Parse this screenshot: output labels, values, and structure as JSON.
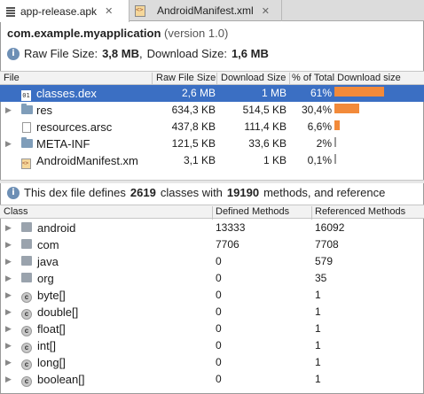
{
  "tabs": [
    {
      "label": "app-release.apk",
      "active": true
    },
    {
      "label": "AndroidManifest.xml",
      "active": false
    }
  ],
  "header": {
    "package": "com.example.myapplication",
    "version": "(version 1.0)",
    "raw_label": "Raw File Size:",
    "raw_value": "3,8 MB",
    "sep": ",",
    "download_label": "Download Size:",
    "download_value": "1,6 MB"
  },
  "files_table": {
    "columns": [
      "File",
      "Raw File Size",
      "Download Size",
      "% of Total Download size"
    ],
    "rows": [
      {
        "name": "classes.dex",
        "raw": "2,6 MB",
        "download": "1 MB",
        "percent": "61%",
        "share": 0.61,
        "selected": true,
        "icon": "dex-file-icon",
        "expandable": false
      },
      {
        "name": "res",
        "raw": "634,3 KB",
        "download": "514,5 KB",
        "percent": "30,4%",
        "share": 0.304,
        "selected": false,
        "icon": "folder-icon",
        "expandable": true
      },
      {
        "name": "resources.arsc",
        "raw": "437,8 KB",
        "download": "111,4 KB",
        "percent": "6,6%",
        "share": 0.066,
        "selected": false,
        "icon": "file-icon",
        "expandable": false
      },
      {
        "name": "META-INF",
        "raw": "121,5 KB",
        "download": "33,6 KB",
        "percent": "2%",
        "share": 0.02,
        "selected": false,
        "icon": "folder-icon",
        "expandable": true
      },
      {
        "name": "AndroidManifest.xm",
        "raw": "3,1 KB",
        "download": "1 KB",
        "percent": "0,1%",
        "share": 0.001,
        "selected": false,
        "icon": "xml-file-icon",
        "expandable": false
      }
    ]
  },
  "dex_summary": {
    "prefix": "This dex file defines",
    "classes": "2619",
    "mid1": "classes with",
    "methods": "19190",
    "mid2": "methods, and reference"
  },
  "classes_table": {
    "columns": [
      "Class",
      "Defined Methods",
      "Referenced Methods"
    ],
    "rows": [
      {
        "name": "android",
        "defined": "13333",
        "referenced": "16092",
        "kind": "package"
      },
      {
        "name": "com",
        "defined": "7706",
        "referenced": "7708",
        "kind": "package"
      },
      {
        "name": "java",
        "defined": "0",
        "referenced": "579",
        "kind": "package"
      },
      {
        "name": "org",
        "defined": "0",
        "referenced": "35",
        "kind": "package"
      },
      {
        "name": "byte[]",
        "defined": "0",
        "referenced": "1",
        "kind": "class"
      },
      {
        "name": "double[]",
        "defined": "0",
        "referenced": "1",
        "kind": "class"
      },
      {
        "name": "float[]",
        "defined": "0",
        "referenced": "1",
        "kind": "class"
      },
      {
        "name": "int[]",
        "defined": "0",
        "referenced": "1",
        "kind": "class"
      },
      {
        "name": "long[]",
        "defined": "0",
        "referenced": "1",
        "kind": "class"
      },
      {
        "name": "boolean[]",
        "defined": "0",
        "referenced": "1",
        "kind": "class"
      }
    ]
  },
  "colors": {
    "selection": "#3b6fc3",
    "bar": "#f28a3a"
  }
}
